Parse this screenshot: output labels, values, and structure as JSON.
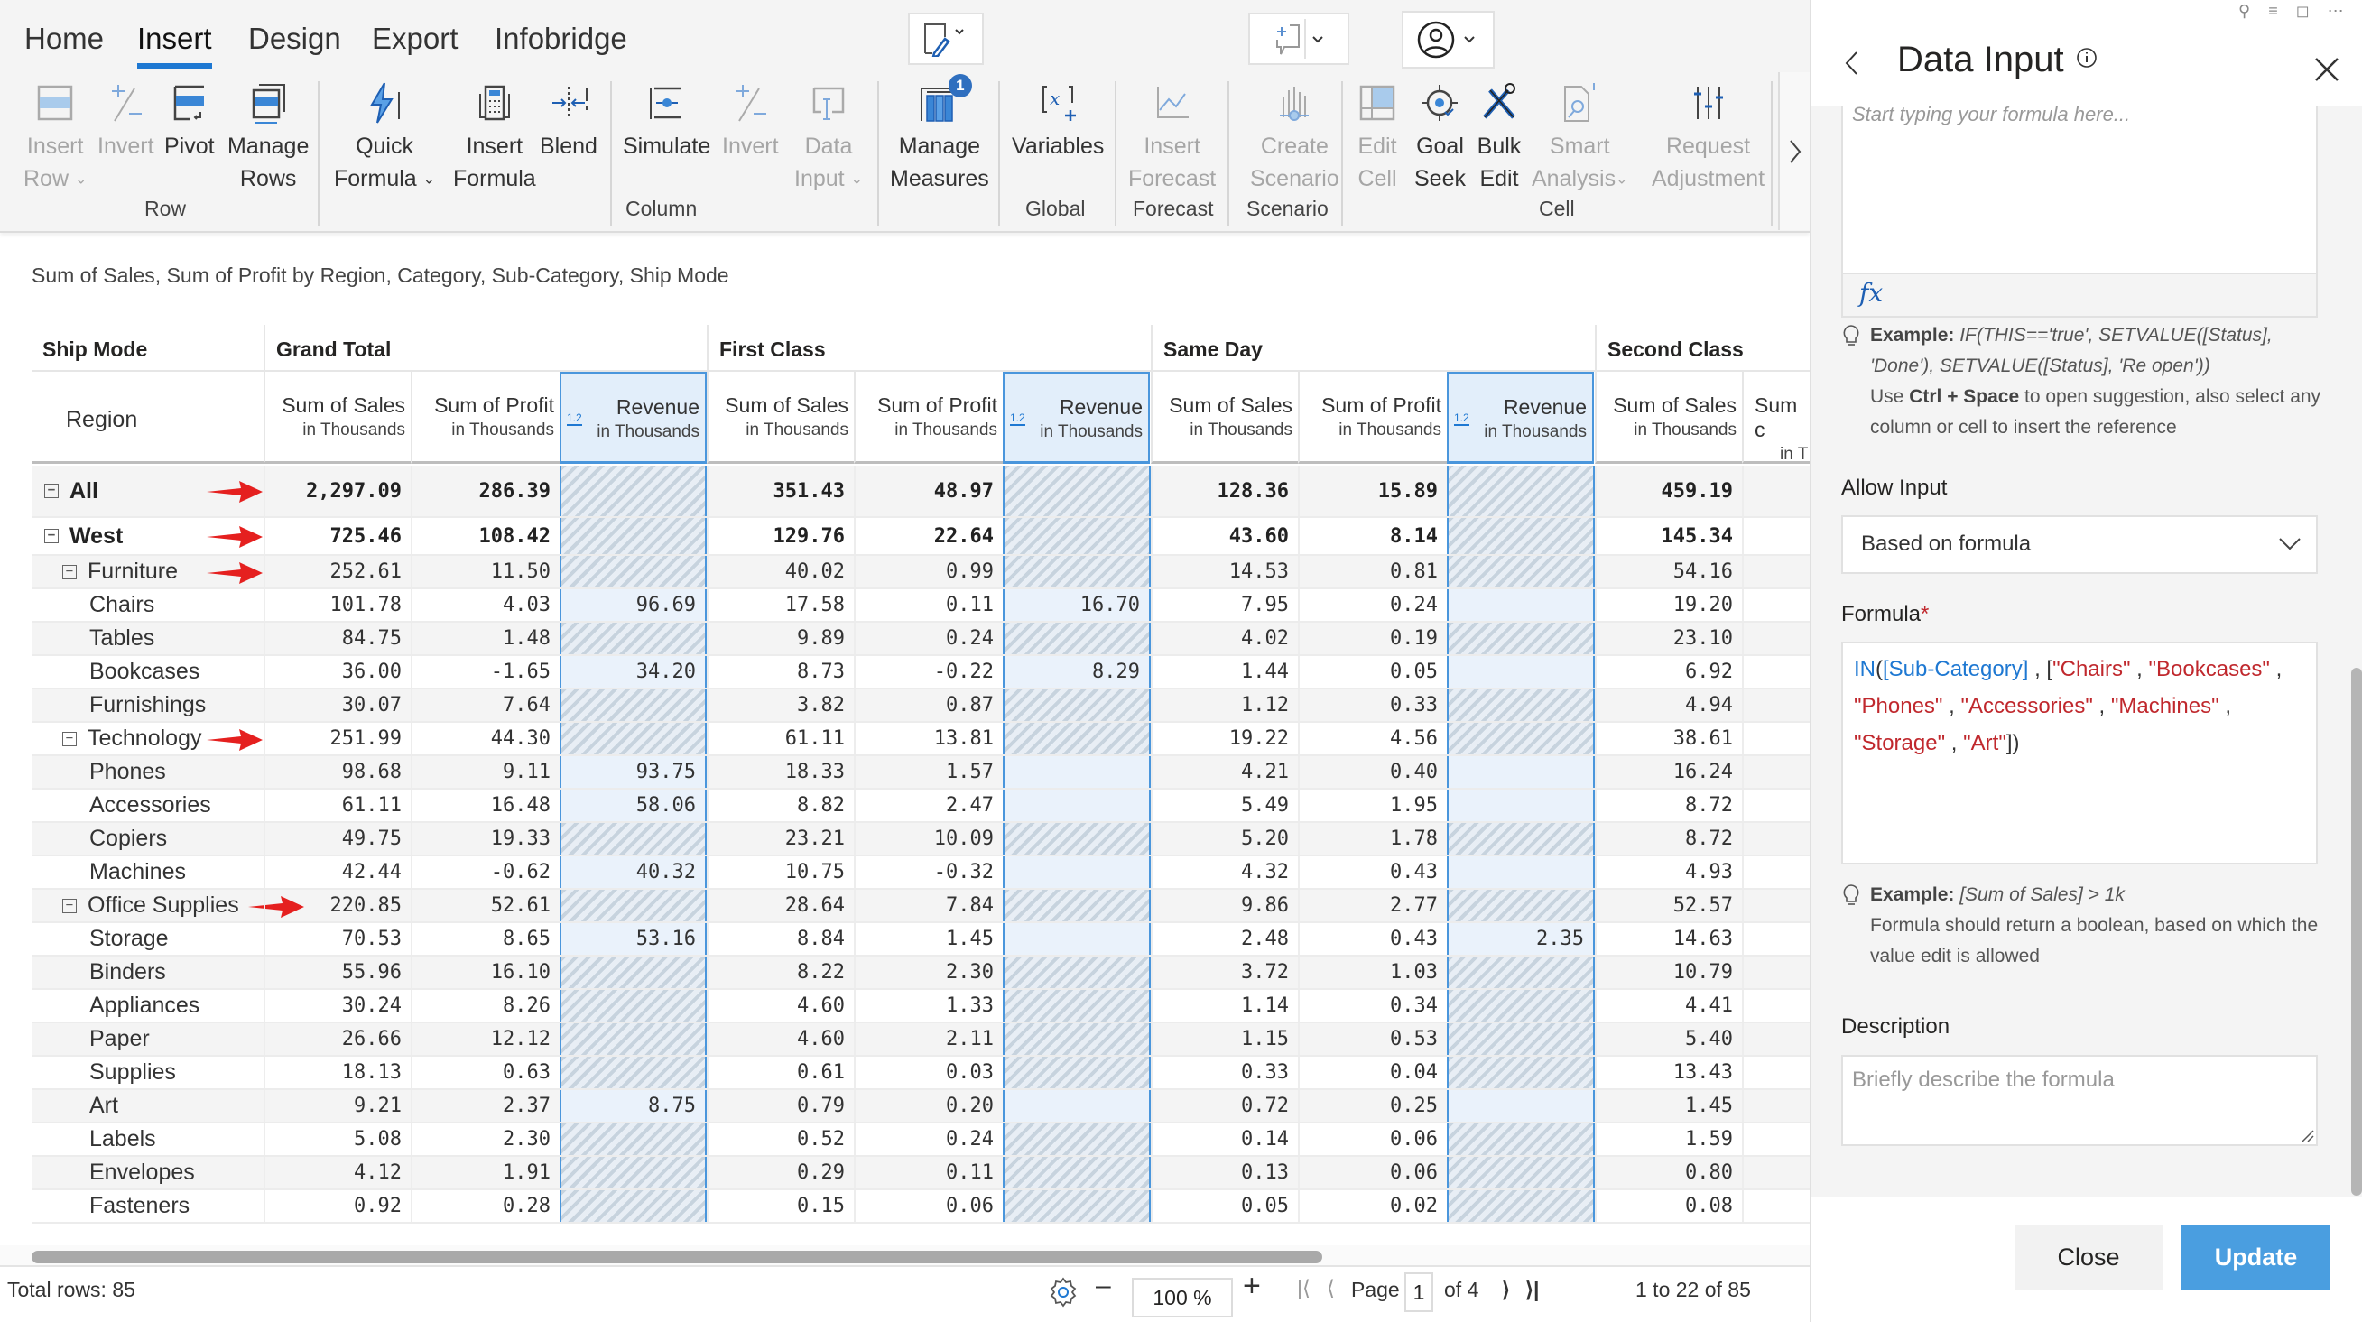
{
  "ribbon": {
    "tabs": [
      {
        "label": "Home",
        "active": false
      },
      {
        "label": "Insert",
        "active": true
      },
      {
        "label": "Design",
        "active": false
      },
      {
        "label": "Export",
        "active": false
      },
      {
        "label": "Infobridge",
        "active": false
      }
    ],
    "groups": {
      "row": "Row",
      "column": "Column",
      "global": "Global",
      "forecast": "Forecast",
      "scenario": "Scenario",
      "cell": "Cell"
    },
    "buttons": {
      "insert_row": [
        "Insert",
        "Row"
      ],
      "invert_row": [
        "Invert",
        ""
      ],
      "pivot": [
        "Pivot",
        ""
      ],
      "manage_rows": [
        "Manage",
        "Rows"
      ],
      "quick_formula": [
        "Quick",
        "Formula"
      ],
      "insert_formula": [
        "Insert",
        "Formula"
      ],
      "blend": [
        "Blend",
        ""
      ],
      "simulate": [
        "Simulate",
        ""
      ],
      "invert_col": [
        "Invert",
        ""
      ],
      "data_input": [
        "Data",
        "Input"
      ],
      "manage_measures": [
        "Manage",
        "Measures"
      ],
      "manage_measures_badge": "1",
      "variables": [
        "Variables",
        ""
      ],
      "insert_forecast": [
        "Insert",
        "Forecast"
      ],
      "create_scenario": [
        "Create",
        "Scenario"
      ],
      "edit_cell": [
        "Edit",
        "Cell"
      ],
      "goal_seek": [
        "Goal",
        "Seek"
      ],
      "bulk_edit": [
        "Bulk",
        "Edit"
      ],
      "smart_analysis": [
        "Smart",
        "Analysis"
      ],
      "request_adjustment": [
        "Request",
        "Adjustment"
      ]
    },
    "icons": [
      "edit-layout-icon",
      "add-comment-icon",
      "user-icon",
      "chevron-right-icon"
    ]
  },
  "report": {
    "caption": "Sum of Sales, Sum of Profit by Region, Category, Sub-Category, Ship Mode",
    "corner_header": "Ship Mode",
    "row_header": "Region",
    "column_groups": [
      "Grand Total",
      "First Class",
      "Same Day",
      "Second Class"
    ],
    "measures": [
      {
        "name": "Sum of Sales",
        "unit": "in Thousands"
      },
      {
        "name": "Sum of Profit",
        "unit": "in Thousands"
      },
      {
        "name": "Revenue",
        "unit": "in Thousands",
        "badge": "1.2"
      }
    ],
    "partial_measures": {
      "name": "Sum c",
      "unit": "in T"
    },
    "rows": [
      {
        "label": "All",
        "level": 0,
        "bold": true,
        "toggle": true,
        "arrow": true,
        "gt": [
          "2,297.09",
          "286.39",
          ""
        ],
        "fc": [
          "351.43",
          "48.97",
          ""
        ],
        "sd": [
          "128.36",
          "15.89",
          ""
        ],
        "sc": "459.19",
        "editable": [
          false,
          false,
          false
        ]
      },
      {
        "label": "West",
        "level": 0,
        "bold": true,
        "toggle": true,
        "arrow": true,
        "gt": [
          "725.46",
          "108.42",
          ""
        ],
        "fc": [
          "129.76",
          "22.64",
          ""
        ],
        "sd": [
          "43.60",
          "8.14",
          ""
        ],
        "sc": "145.34",
        "editable": [
          false,
          false,
          false
        ]
      },
      {
        "label": "Furniture",
        "level": 1,
        "bold": false,
        "toggle": true,
        "arrow": true,
        "gt": [
          "252.61",
          "11.50",
          ""
        ],
        "fc": [
          "40.02",
          "0.99",
          ""
        ],
        "sd": [
          "14.53",
          "0.81",
          ""
        ],
        "sc": "54.16",
        "editable": [
          false,
          false,
          false
        ]
      },
      {
        "label": "Chairs",
        "level": 2,
        "gt": [
          "101.78",
          "4.03",
          "96.69"
        ],
        "fc": [
          "17.58",
          "0.11",
          "16.70"
        ],
        "sd": [
          "7.95",
          "0.24",
          ""
        ],
        "sc": "19.20",
        "editable": [
          true,
          true,
          true
        ]
      },
      {
        "label": "Tables",
        "level": 2,
        "gt": [
          "84.75",
          "1.48",
          ""
        ],
        "fc": [
          "9.89",
          "0.24",
          ""
        ],
        "sd": [
          "4.02",
          "0.19",
          ""
        ],
        "sc": "23.10",
        "editable": [
          false,
          false,
          false
        ]
      },
      {
        "label": "Bookcases",
        "level": 2,
        "gt": [
          "36.00",
          "-1.65",
          "34.20"
        ],
        "fc": [
          "8.73",
          "-0.22",
          "8.29"
        ],
        "sd": [
          "1.44",
          "0.05",
          ""
        ],
        "sc": "6.92",
        "editable": [
          true,
          true,
          true
        ]
      },
      {
        "label": "Furnishings",
        "level": 2,
        "gt": [
          "30.07",
          "7.64",
          ""
        ],
        "fc": [
          "3.82",
          "0.87",
          ""
        ],
        "sd": [
          "1.12",
          "0.33",
          ""
        ],
        "sc": "4.94",
        "editable": [
          false,
          false,
          false
        ]
      },
      {
        "label": "Technology",
        "level": 1,
        "toggle": true,
        "arrow": true,
        "gt": [
          "251.99",
          "44.30",
          ""
        ],
        "fc": [
          "61.11",
          "13.81",
          ""
        ],
        "sd": [
          "19.22",
          "4.56",
          ""
        ],
        "sc": "38.61",
        "editable": [
          false,
          false,
          false
        ]
      },
      {
        "label": "Phones",
        "level": 2,
        "gt": [
          "98.68",
          "9.11",
          "93.75"
        ],
        "fc": [
          "18.33",
          "1.57",
          ""
        ],
        "sd": [
          "4.21",
          "0.40",
          ""
        ],
        "sc": "16.24",
        "editable": [
          true,
          true,
          true
        ]
      },
      {
        "label": "Accessories",
        "level": 2,
        "gt": [
          "61.11",
          "16.48",
          "58.06"
        ],
        "fc": [
          "8.82",
          "2.47",
          ""
        ],
        "sd": [
          "5.49",
          "1.95",
          ""
        ],
        "sc": "8.72",
        "editable": [
          true,
          true,
          true
        ]
      },
      {
        "label": "Copiers",
        "level": 2,
        "gt": [
          "49.75",
          "19.33",
          ""
        ],
        "fc": [
          "23.21",
          "10.09",
          ""
        ],
        "sd": [
          "5.20",
          "1.78",
          ""
        ],
        "sc": "8.72",
        "editable": [
          false,
          false,
          false
        ]
      },
      {
        "label": "Machines",
        "level": 2,
        "gt": [
          "42.44",
          "-0.62",
          "40.32"
        ],
        "fc": [
          "10.75",
          "-0.32",
          ""
        ],
        "sd": [
          "4.32",
          "0.43",
          ""
        ],
        "sc": "4.93",
        "editable": [
          true,
          true,
          true
        ]
      },
      {
        "label": "Office Supplies",
        "level": 1,
        "toggle": true,
        "arrow": true,
        "gt": [
          "220.85",
          "52.61",
          ""
        ],
        "fc": [
          "28.64",
          "7.84",
          ""
        ],
        "sd": [
          "9.86",
          "2.77",
          ""
        ],
        "sc": "52.57",
        "editable": [
          false,
          false,
          false
        ]
      },
      {
        "label": "Storage",
        "level": 2,
        "gt": [
          "70.53",
          "8.65",
          "53.16"
        ],
        "fc": [
          "8.84",
          "1.45",
          ""
        ],
        "sd": [
          "2.48",
          "0.43",
          "2.35"
        ],
        "sc": "14.63",
        "editable": [
          true,
          true,
          true
        ]
      },
      {
        "label": "Binders",
        "level": 2,
        "gt": [
          "55.96",
          "16.10",
          ""
        ],
        "fc": [
          "8.22",
          "2.30",
          ""
        ],
        "sd": [
          "3.72",
          "1.03",
          ""
        ],
        "sc": "10.79",
        "editable": [
          false,
          false,
          false
        ]
      },
      {
        "label": "Appliances",
        "level": 2,
        "gt": [
          "30.24",
          "8.26",
          ""
        ],
        "fc": [
          "4.60",
          "1.33",
          ""
        ],
        "sd": [
          "1.14",
          "0.34",
          ""
        ],
        "sc": "4.41",
        "editable": [
          false,
          false,
          false
        ]
      },
      {
        "label": "Paper",
        "level": 2,
        "gt": [
          "26.66",
          "12.12",
          ""
        ],
        "fc": [
          "4.60",
          "2.11",
          ""
        ],
        "sd": [
          "1.15",
          "0.53",
          ""
        ],
        "sc": "5.40",
        "editable": [
          false,
          false,
          false
        ]
      },
      {
        "label": "Supplies",
        "level": 2,
        "gt": [
          "18.13",
          "0.63",
          ""
        ],
        "fc": [
          "0.61",
          "0.03",
          ""
        ],
        "sd": [
          "0.33",
          "0.04",
          ""
        ],
        "sc": "13.43",
        "editable": [
          false,
          false,
          false
        ]
      },
      {
        "label": "Art",
        "level": 2,
        "gt": [
          "9.21",
          "2.37",
          "8.75"
        ],
        "fc": [
          "0.79",
          "0.20",
          ""
        ],
        "sd": [
          "0.72",
          "0.25",
          ""
        ],
        "sc": "1.45",
        "editable": [
          true,
          true,
          true
        ]
      },
      {
        "label": "Labels",
        "level": 2,
        "gt": [
          "5.08",
          "2.30",
          ""
        ],
        "fc": [
          "0.52",
          "0.24",
          ""
        ],
        "sd": [
          "0.14",
          "0.06",
          ""
        ],
        "sc": "1.59",
        "editable": [
          false,
          false,
          false
        ]
      },
      {
        "label": "Envelopes",
        "level": 2,
        "gt": [
          "4.12",
          "1.91",
          ""
        ],
        "fc": [
          "0.29",
          "0.11",
          ""
        ],
        "sd": [
          "0.13",
          "0.06",
          ""
        ],
        "sc": "0.80",
        "editable": [
          false,
          false,
          false
        ]
      },
      {
        "label": "Fasteners",
        "level": 2,
        "gt": [
          "0.92",
          "0.28",
          ""
        ],
        "fc": [
          "0.15",
          "0.06",
          ""
        ],
        "sd": [
          "0.05",
          "0.02",
          ""
        ],
        "sc": "0.08",
        "editable": [
          false,
          false,
          false
        ]
      }
    ]
  },
  "footer": {
    "total_rows": "Total rows: 85",
    "zoom": "100 %",
    "page_label": "Page",
    "page": "1",
    "of_pages": "of 4",
    "range": "1 to 22 of 85"
  },
  "panel": {
    "title": "Data Input",
    "formula_editor_placeholder": "Start typing your formula here...",
    "fx": "fx",
    "example1_label": "Example",
    "example1_code_line1": "IF(THIS=='true', SETVALUE([Status],",
    "example1_code_line2": "'Done'), SETVALUE([Status], 'Re open'))",
    "example1_tip_pre": "Use ",
    "example1_tip_key": "Ctrl + Space",
    "example1_tip_post": " to open suggestion, also select any column or cell to insert the reference",
    "allow_input_label": "Allow Input",
    "allow_input_value": "Based on formula",
    "formula_label": "Formula",
    "formula_required": "*",
    "formula_tokens": [
      {
        "t": "IN",
        "c": "fn"
      },
      {
        "t": "(",
        "c": "p"
      },
      {
        "t": "[Sub-Category]",
        "c": "fn"
      },
      {
        "t": " , [",
        "c": "p"
      },
      {
        "t": "\"Chairs\"",
        "c": "s"
      },
      {
        "t": " , ",
        "c": "p"
      },
      {
        "t": "\"Bookcases\"",
        "c": "s"
      },
      {
        "t": " , ",
        "c": "p"
      },
      {
        "t": "\"Phones\"",
        "c": "s"
      },
      {
        "t": " , ",
        "c": "p"
      },
      {
        "t": "\"Accessories\"",
        "c": "s"
      },
      {
        "t": " , ",
        "c": "p"
      },
      {
        "t": "\"Machines\"",
        "c": "s"
      },
      {
        "t": " , ",
        "c": "p"
      },
      {
        "t": "\"Storage\"",
        "c": "s"
      },
      {
        "t": " , ",
        "c": "p"
      },
      {
        "t": "\"Art\"",
        "c": "s"
      },
      {
        "t": "])",
        "c": "p"
      }
    ],
    "example2_label": "Example",
    "example2_code": "[Sum of Sales] > 1k",
    "example2_text": "Formula should return a boolean, based on which the value edit is allowed",
    "description_label": "Description",
    "description_placeholder": "Briefly describe the formula",
    "close_label": "Close",
    "update_label": "Update"
  },
  "colors": {
    "accent": "#1e78d2",
    "update_button": "#4a9ee0",
    "formula_function": "#1e78d2",
    "formula_string": "#c0282d",
    "arrow": "#e5201f",
    "revenue_column_border": "#4a96dc"
  }
}
